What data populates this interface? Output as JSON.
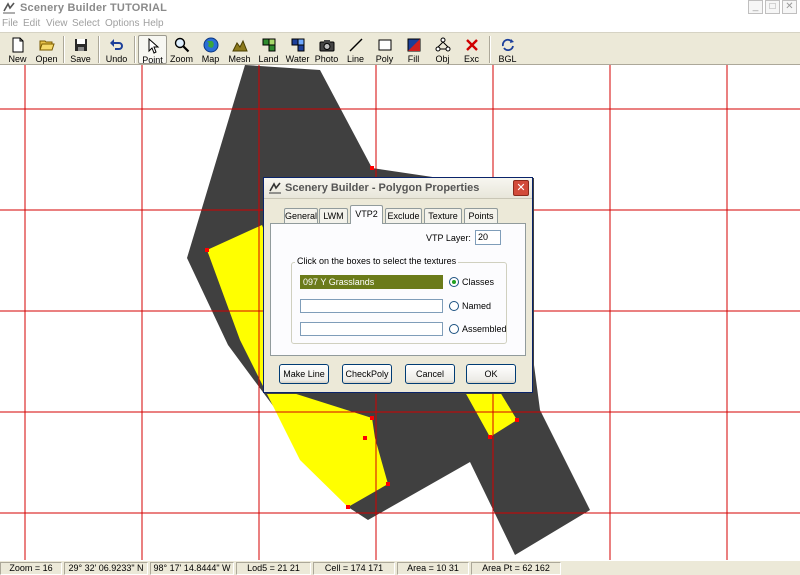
{
  "window": {
    "title": "Scenery Builder  TUTORIAL",
    "minimize": "_",
    "maximize": "□",
    "close": "✕"
  },
  "menu": [
    "File",
    "Edit",
    "View",
    "Select",
    "Options",
    "Help"
  ],
  "toolbar": {
    "active": "Point",
    "buttons": [
      {
        "label": "New",
        "icon": "new-file-icon"
      },
      {
        "label": "Open",
        "icon": "open-folder-icon"
      },
      {
        "label": "Save",
        "icon": "save-disk-icon"
      },
      {
        "label": "Undo",
        "icon": "undo-arrow-icon"
      },
      {
        "label": "Point",
        "icon": "pointer-icon"
      },
      {
        "label": "Zoom",
        "icon": "magnifier-icon"
      },
      {
        "label": "Map",
        "icon": "globe-icon"
      },
      {
        "label": "Mesh",
        "icon": "mesh-mountain-icon"
      },
      {
        "label": "Land",
        "icon": "land-icon"
      },
      {
        "label": "Water",
        "icon": "water-icon"
      },
      {
        "label": "Photo",
        "icon": "camera-icon"
      },
      {
        "label": "Line",
        "icon": "line-icon"
      },
      {
        "label": "Poly",
        "icon": "polygon-icon"
      },
      {
        "label": "Fill",
        "icon": "fill-icon"
      },
      {
        "label": "Obj",
        "icon": "object-icon"
      },
      {
        "label": "Exc",
        "icon": "exclude-x-icon"
      },
      {
        "label": "BGL",
        "icon": "bgl-compile-icon"
      }
    ]
  },
  "status": {
    "zoom": "Zoom = 16",
    "lat": "29° 32' 06.9233\" N",
    "lon": "98° 17' 14.8444\" W",
    "lod": "Lod5 = 21 21",
    "cell": "Cell = 174 171",
    "area": "Area = 10 31",
    "area_pt": "Area Pt = 62 162"
  },
  "dialog": {
    "title": "Scenery Builder - Polygon Properties",
    "close": "✕",
    "active_tab": "VTP2",
    "tabs": [
      "General",
      "LWM",
      "VTP2",
      "Exclude",
      "Texture",
      "Points"
    ],
    "vtp_layer_label": "VTP Layer:",
    "vtp_layer_value": "20",
    "group_legend": "Click on the boxes to select the textures",
    "textures": [
      {
        "value": "097 Y Grasslands",
        "option": "Classes",
        "checked": true
      },
      {
        "value": "",
        "option": "Named",
        "checked": false
      },
      {
        "value": "",
        "option": "Assembled",
        "checked": false
      }
    ],
    "buttons": {
      "make_line": "Make Line",
      "check_poly": "CheckPoly",
      "cancel": "Cancel",
      "ok": "OK"
    }
  },
  "colors": {
    "grid": "#d40000",
    "polygon_dark": "#404040",
    "polygon_fill": "#ffff00",
    "vertex": "#ff0000",
    "texture_selected": "#6b7b1a"
  }
}
